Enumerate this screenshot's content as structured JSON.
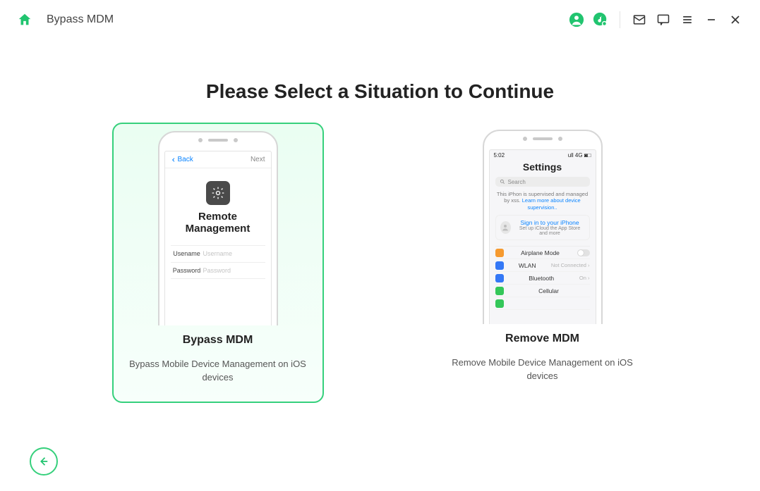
{
  "titlebar": {
    "title": "Bypass MDM"
  },
  "heading": "Please Select a Situation to Continue",
  "cards": {
    "bypass": {
      "name": "Bypass MDM",
      "desc": "Bypass Mobile Device Management on iOS devices",
      "phone": {
        "back": "Back",
        "next": "Next",
        "title": "Remote Management",
        "username_label": "Usename",
        "username_placeholder": "Username",
        "password_label": "Password",
        "password_placeholder": "Password"
      }
    },
    "remove": {
      "name": "Remove MDM",
      "desc": "Remove Mobile Device Management on iOS devices",
      "phone": {
        "time": "5:02",
        "signal": "ull 4G ◙□",
        "title": "Settings",
        "search": "Search",
        "supervised": "This iPhon is supervised and managed by xss.",
        "supervised_link": "Learn more about device supervision..",
        "signin": "Sign in to your iPhone",
        "signin_sub": "Set up iCloud the App Store and more",
        "items": [
          {
            "label": "Airplane Mode",
            "value": "",
            "color": "#f69a2f"
          },
          {
            "label": "WLAN",
            "value": "Not Connected ›",
            "color": "#3478f6"
          },
          {
            "label": "Bluetooth",
            "value": "On ›",
            "color": "#3478f6"
          },
          {
            "label": "Cellular",
            "value": "",
            "color": "#34c759"
          },
          {
            "label": "",
            "value": "",
            "color": "#34c759"
          }
        ]
      }
    }
  }
}
